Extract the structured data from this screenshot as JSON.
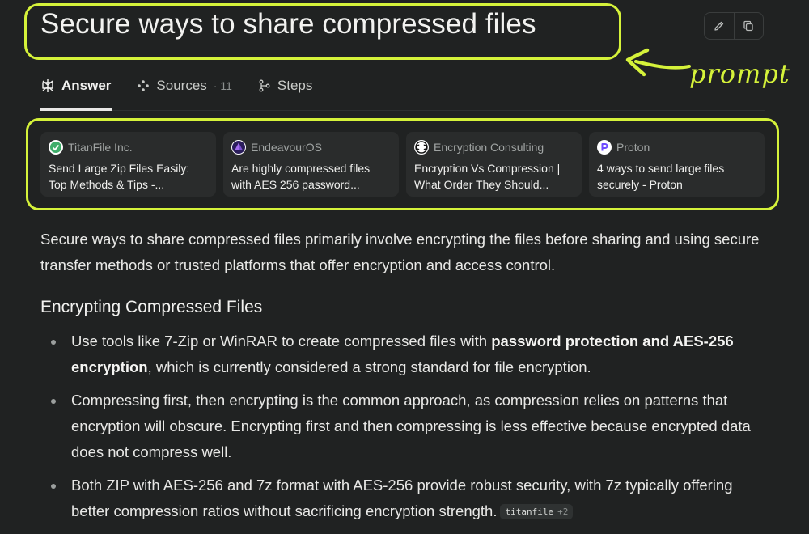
{
  "query": {
    "title": "Secure ways to share compressed files"
  },
  "annotation": {
    "label": "prompt",
    "color": "#d5f23a"
  },
  "actions": {
    "edit_icon": "pencil-icon",
    "copy_icon": "copy-icon"
  },
  "tabs": [
    {
      "label": "Answer",
      "icon": "perplexity-icon",
      "active": true
    },
    {
      "label": "Sources",
      "icon": "sources-icon",
      "count": "· 11"
    },
    {
      "label": "Steps",
      "icon": "steps-icon"
    }
  ],
  "sources": [
    {
      "name": "TitanFile Inc.",
      "title": "Send Large Zip Files Easily: Top Methods & Tips -...",
      "favicon_color": "#3fae6a"
    },
    {
      "name": "EndeavourOS",
      "title": "Are highly compressed files with AES 256 password...",
      "favicon_color": "#7b4fd0"
    },
    {
      "name": "Encryption Consulting",
      "title": "Encryption Vs Compression | What Order They Should...",
      "favicon_color": "#ffffff"
    },
    {
      "name": "Proton",
      "title": "4 ways to send large files securely - Proton",
      "favicon_color": "#6d4aff"
    }
  ],
  "answer": {
    "intro": "Secure ways to share compressed files primarily involve encrypting the files before sharing and using secure transfer methods or trusted platforms that offer encryption and access control.",
    "heading": "Encrypting Compressed Files",
    "bullet1": {
      "before": "Use tools like 7-Zip or WinRAR to create compressed files with ",
      "bold": "password protection and AES-256 encryption",
      "after": ", which is currently considered a strong standard for file encryption."
    },
    "bullet2": "Compressing first, then encrypting is the common approach, as compression relies on patterns that encryption will obscure. Encrypting first and then compressing is less effective because encrypted data does not compress well.",
    "bullet3": "Both ZIP with AES-256 and 7z format with AES-256 provide robust security, with 7z typically offering better compression ratios without sacrificing encryption strength.",
    "citation": {
      "source": "titanfile",
      "more": "+2"
    }
  }
}
